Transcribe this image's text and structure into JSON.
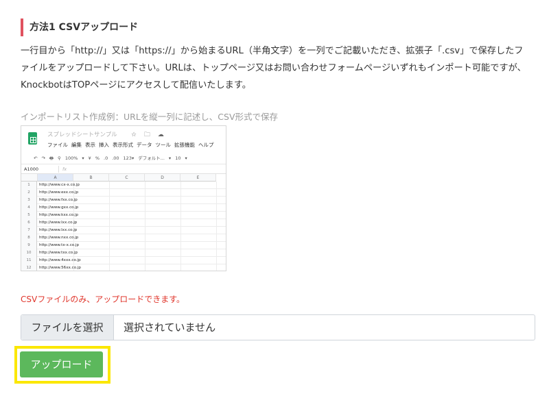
{
  "section": {
    "title": "方法1 CSVアップロード",
    "accent_color": "#e0525f",
    "description": "一行目から「http://」又は「https://」から始まるURL（半角文字）を一列でご記載いただき、拡張子「.csv」で保存したファイルをアップロードして下さい。URLは、トップページ又はお問い合わせフォームページいずれもインポート可能ですが、KnockbotはTOPページにアクセスして配信いたします。"
  },
  "example": {
    "caption": "インポートリスト作成例：URLを縦一列に記述し、CSV形式で保存",
    "sheet": {
      "doc_title": "スプレッドシートサンプル",
      "title_icons": "☆ 🗀 ☁",
      "menu": [
        "ファイル",
        "編集",
        "表示",
        "挿入",
        "表示形式",
        "データ",
        "ツール",
        "拡張機能",
        "ヘルプ"
      ],
      "toolbar": [
        "↶",
        "↷",
        "🖶",
        "⚲",
        "100%",
        "▾",
        "¥",
        "%",
        ".0",
        ".00",
        "123▾",
        "デフォルト...",
        "▾",
        "10",
        "▾"
      ],
      "cell_ref": "A1000",
      "fx": "fx",
      "columns": [
        "A",
        "B",
        "C",
        "D",
        "E"
      ],
      "rows": [
        {
          "num": "1",
          "value": "http://www.cx-x.co.jp"
        },
        {
          "num": "2",
          "value": "http://www.exx.co.jp"
        },
        {
          "num": "3",
          "value": "http://www.fxx.co.jp"
        },
        {
          "num": "4",
          "value": "http://www.gxx.co.jp"
        },
        {
          "num": "5",
          "value": "http://www.kxx.co.jp"
        },
        {
          "num": "6",
          "value": "http://www.lxx.co.jp"
        },
        {
          "num": "7",
          "value": "http://www.lxx.co.jp"
        },
        {
          "num": "8",
          "value": "http://www.nxx.co.jp"
        },
        {
          "num": "9",
          "value": "http://www.tx-x.co.jp"
        },
        {
          "num": "10",
          "value": "http://www.txx.co.jp"
        },
        {
          "num": "11",
          "value": "http://www.4xxx.co.jp"
        },
        {
          "num": "12",
          "value": "http://www.56xx.co.jp"
        }
      ]
    }
  },
  "upload": {
    "warning": "CSVファイルのみ、アップロードできます。",
    "warning_color": "#e0352b",
    "choose_file_label": "ファイルを選択",
    "file_status": "選択されていません",
    "submit_label": "アップロード",
    "submit_color": "#5cb85c",
    "highlight_color": "#fbe700"
  }
}
